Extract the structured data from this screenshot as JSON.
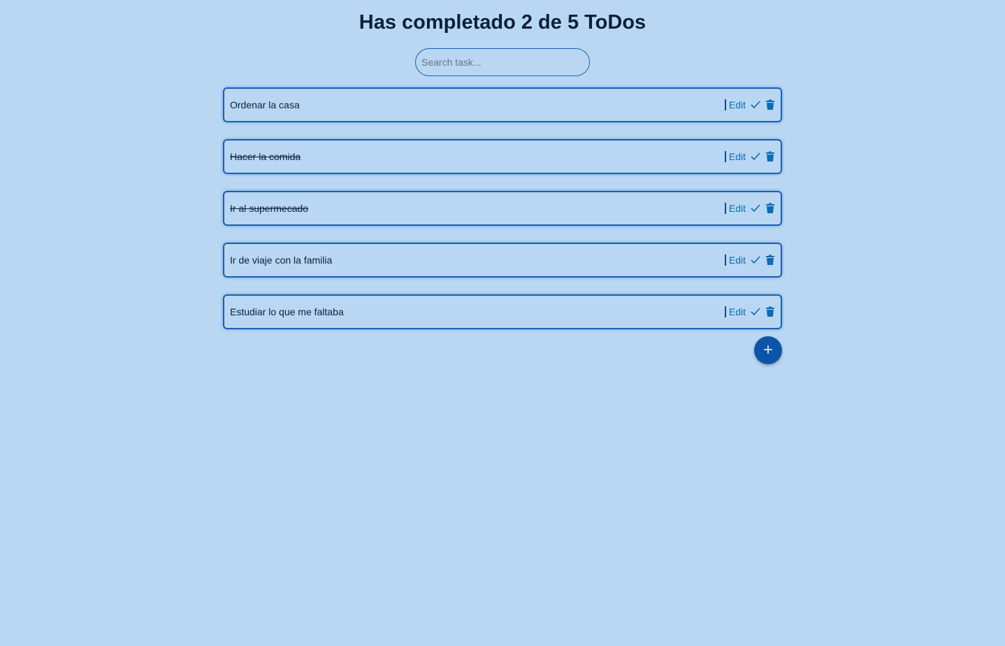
{
  "header": {
    "title": "Has completado 2 de 5 ToDos"
  },
  "search": {
    "placeholder": "Search task..."
  },
  "todos": [
    {
      "text": "Ordenar la casa",
      "completed": false
    },
    {
      "text": "Hacer la comida",
      "completed": true
    },
    {
      "text": "Ir al supermecado",
      "completed": true
    },
    {
      "text": "Ir de viaje con la familia",
      "completed": false
    },
    {
      "text": "Estudiar lo que me faltaba",
      "completed": false
    }
  ],
  "actions": {
    "edit_label": "Edit",
    "complete_icon": "check-icon",
    "delete_icon": "trash-icon"
  },
  "add_button": {
    "label": "+"
  }
}
